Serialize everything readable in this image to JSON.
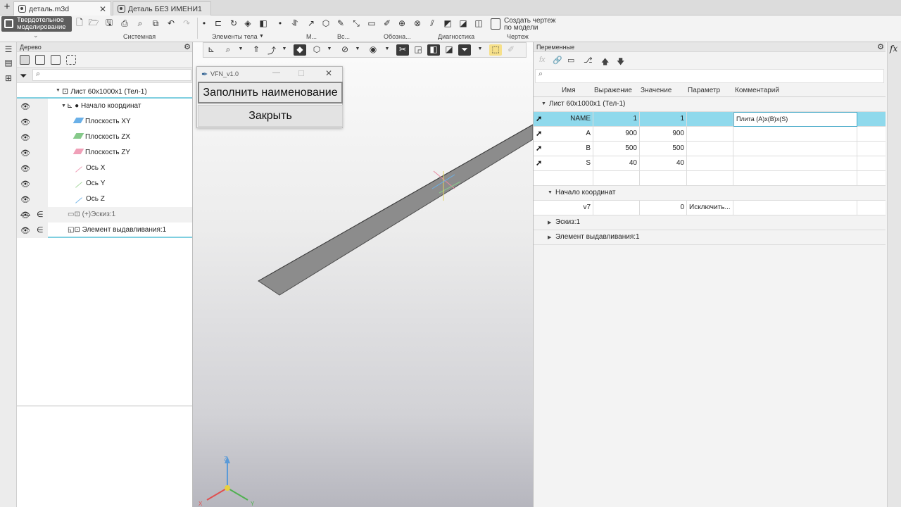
{
  "tabs": [
    {
      "label": "деталь.m3d",
      "close": "✕"
    },
    {
      "label": "Деталь БЕЗ ИМЕНИ1",
      "close": ""
    }
  ],
  "ribbon": {
    "mode_label": "Твердотельное моделирование",
    "groups": [
      "Системная",
      "Элементы тела",
      "М...",
      "Вс...",
      "Обозна...",
      "Диагностика",
      "Чертеж"
    ],
    "create_drawing": "Создать чертеж по модели"
  },
  "tree": {
    "title": "Дерево",
    "search_placeholder": "⌕",
    "rows": [
      {
        "label": "Лист 60x1000x1 (Тел-1)"
      },
      {
        "label": "Начало координат"
      },
      {
        "label": "Плоскость XY",
        "color": "#6ab0e8"
      },
      {
        "label": "Плоскость ZX",
        "color": "#86c98a"
      },
      {
        "label": "Плоскость ZY",
        "color": "#f0a0b8"
      },
      {
        "label": "Ось X",
        "color": "#f0a0b8"
      },
      {
        "label": "Ось Y",
        "color": "#a8d8a0"
      },
      {
        "label": "Ось Z",
        "color": "#7ab8e8"
      },
      {
        "label": "(+)Эскиз:1"
      },
      {
        "label": "Элемент выдавливания:1"
      }
    ]
  },
  "plugin": {
    "title": "VFN_v1.0",
    "fill_button": "Заполнить наименование",
    "close_button": "Закрыть"
  },
  "triad": {
    "x": "X",
    "y": "Y",
    "z": "Z"
  },
  "variables": {
    "title": "Переменные",
    "search_placeholder": "⌕",
    "fx_label": "fx",
    "columns": [
      "Имя",
      "Выражение",
      "Значение",
      "Параметр",
      "Комментарий"
    ],
    "sections": [
      {
        "label": "Лист 60x1000x1 (Тел-1)"
      },
      {
        "label": "Начало координат"
      },
      {
        "label": "Эскиз:1"
      },
      {
        "label": "Элемент выдавливания:1"
      }
    ],
    "rows": [
      {
        "name": "NAME",
        "expr": "1",
        "value": "1",
        "param": "",
        "comment": "Плита (A)x(B)x(S)"
      },
      {
        "name": "A",
        "expr": "900",
        "value": "900",
        "param": "",
        "comment": ""
      },
      {
        "name": "B",
        "expr": "500",
        "value": "500",
        "param": "",
        "comment": ""
      },
      {
        "name": "S",
        "expr": "40",
        "value": "40",
        "param": "",
        "comment": ""
      }
    ],
    "origin_row": {
      "name": "v7",
      "expr": "",
      "value": "0",
      "param": "Исключить..."
    }
  }
}
